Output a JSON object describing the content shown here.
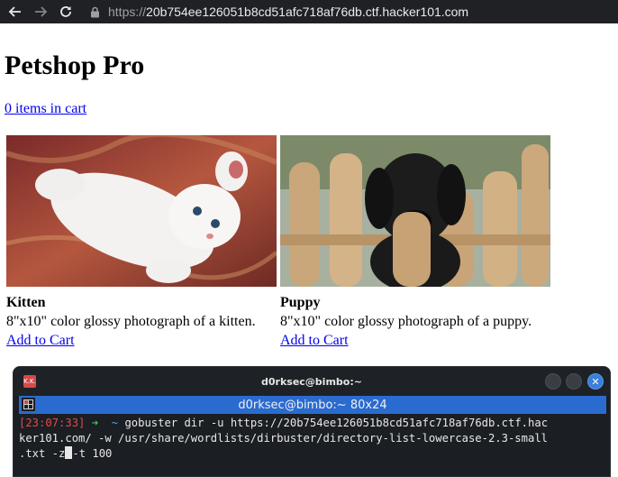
{
  "browser": {
    "url_scheme": "https://",
    "url_host": "20b754ee126051b8cd51afc718af76db.ctf.hacker101.com",
    "back_icon": "arrow-left-icon",
    "forward_icon": "arrow-right-icon",
    "reload_icon": "reload-icon",
    "lock_icon": "lock-icon"
  },
  "page": {
    "title": "Petshop Pro",
    "cart_link": "0 items in cart"
  },
  "products": [
    {
      "name": "Kitten",
      "description": "8\"x10\" color glossy photograph of a kitten.",
      "add_label": "Add to Cart"
    },
    {
      "name": "Puppy",
      "description": "8\"x10\" color glossy photograph of a puppy.",
      "add_label": "Add to Cart"
    }
  ],
  "terminal": {
    "window_title": "d0rksec@bimbo:~",
    "tab_title": "d0rksec@bimbo:~ 80x24",
    "app_icon_text": "K.K.",
    "prompt_time": "[23:07:33]",
    "prompt_arrow": "➜",
    "prompt_dir": "~",
    "command_line1": "gobuster dir -u https://20b754ee126051b8cd51afc718af76db.ctf.hac",
    "command_line2": "ker101.com/ -w /usr/share/wordlists/dirbuster/directory-list-lowercase-2.3-small",
    "command_line3a": ".txt -z",
    "command_line3b": "-t 100"
  },
  "colors": {
    "link": "#0000ee",
    "chrome_bg": "#202124",
    "terminal_bg": "#1b1e22",
    "terminal_tab": "#2a6bd0",
    "prompt_time": "#e04b4b",
    "prompt_arrow": "#3fc85a"
  }
}
